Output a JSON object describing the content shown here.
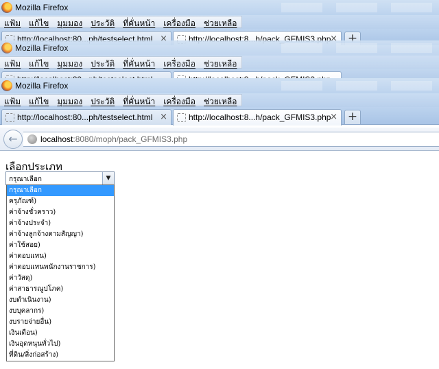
{
  "windows": [
    {
      "title": "Mozilla Firefox",
      "menus": [
        "แฟ้ม",
        "แก้ไข",
        "มุมมอง",
        "ประวัติ",
        "ที่คั่นหน้า",
        "เครื่องมือ",
        "ช่วยเหลือ"
      ],
      "tabs": [
        "http://localhost:80...ph/testselect.html",
        "http://localhost:8...h/pack_GFMIS3.php"
      ]
    },
    {
      "title": "Mozilla Firefox",
      "menus": [
        "แฟ้ม",
        "แก้ไข",
        "มุมมอง",
        "ประวัติ",
        "ที่คั่นหน้า",
        "เครื่องมือ",
        "ช่วยเหลือ"
      ],
      "tabs": [
        "http://localhost:80...ph/testselect.html",
        "http://localhost:8...h/pack_GFMIS3.php"
      ]
    },
    {
      "title": "Mozilla Firefox",
      "menus": [
        "แฟ้ม",
        "แก้ไข",
        "มุมมอง",
        "ประวัติ",
        "ที่คั่นหน้า",
        "เครื่องมือ",
        "ช่วยเหลือ"
      ],
      "tabs": [
        "http://localhost:80...ph/testselect.html",
        "http://localhost:8...h/pack_GFMIS3.php"
      ]
    }
  ],
  "tab_close_glyph": "×",
  "new_tab_glyph": "+",
  "nav": {
    "back_glyph": "←",
    "url_host": "localhost",
    "url_rest": ":8080/moph/pack_GFMIS3.php"
  },
  "form": {
    "label": "เลือกประเภท",
    "selected": "กรุณาเลือก",
    "options": [
      "กรุณาเลือก",
      "ครุภัณฑ์)",
      "ค่าจ้างชั่วคราว)",
      "ค่าจ้างประจำ)",
      "ค่าจ้างลูกจ้างตามสัญญา)",
      "ค่าใช้สอย)",
      "ค่าตอบแทน)",
      "ค่าตอบแทนพนักงานราชการ)",
      "ค่าวัสดุ)",
      "ค่าสาธารณูปโภค)",
      "งบดำเนินงาน)",
      "งบบุคลากร)",
      "งบรายจ่ายอื่น)",
      "เงินเดือน)",
      "เงินอุดหนุนทั่วไป)",
      "ที่ดิน/สิ่งก่อสร้าง)"
    ]
  },
  "colors": {
    "selected_option_bg": "#3399ff",
    "titlebar": "#c4d9f1"
  }
}
